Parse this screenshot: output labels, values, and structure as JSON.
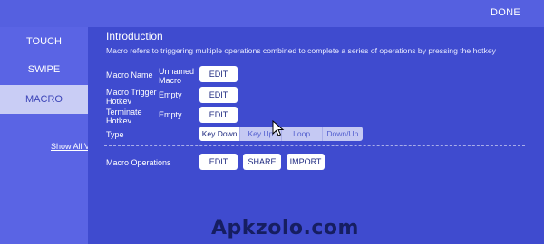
{
  "header": {
    "done_label": "DONE"
  },
  "sidebar": {
    "items": [
      {
        "label": "TOUCH"
      },
      {
        "label": "SWIPE"
      },
      {
        "label": "MACRO",
        "active": true
      }
    ],
    "show_all_label": "Show All V"
  },
  "intro": {
    "title": "Introduction",
    "text": "Macro refers to triggering multiple operations combined to complete a series of operations by pressing the hotkey"
  },
  "rows": {
    "macro_name": {
      "label": "Macro Name",
      "value": "Unnamed Macro",
      "button": "EDIT"
    },
    "trigger": {
      "label": "Macro Trigger Hotkey",
      "value": "Empty",
      "button": "EDIT"
    },
    "terminate": {
      "label": "Terminate Hotkey",
      "value": "Empty",
      "button": "EDIT"
    },
    "type": {
      "label": "Type",
      "options": [
        "Key Down",
        "Key Up",
        "Loop",
        "Down/Up"
      ],
      "selected": "Key Down"
    }
  },
  "operations": {
    "label": "Macro Operations",
    "edit": "EDIT",
    "share": "SHARE",
    "import": "IMPORT"
  },
  "watermark": "Apkzolo.com",
  "colors": {
    "background": "#4f5bd9",
    "panel": "#3f4bcf",
    "sidebar_active": "#c9cdf5",
    "button": "#ffffff"
  }
}
